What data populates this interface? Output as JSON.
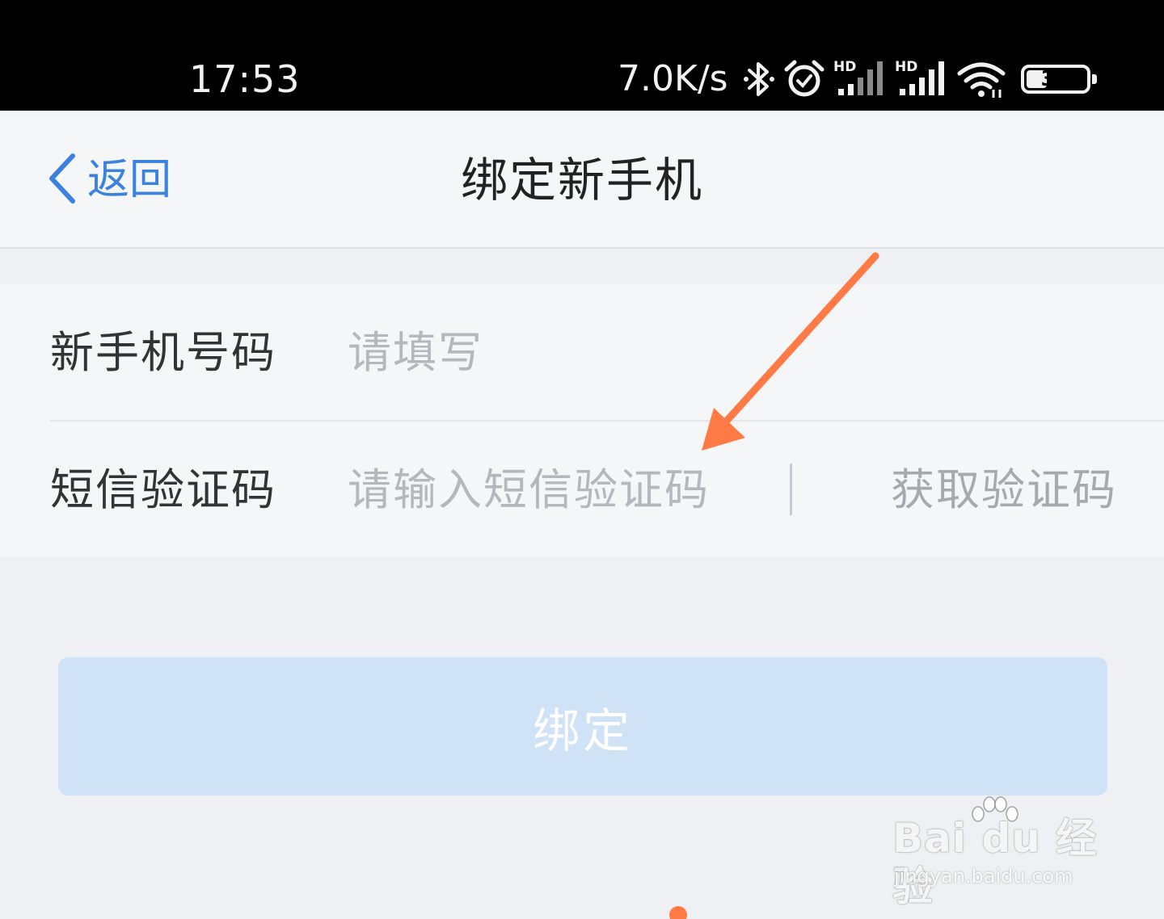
{
  "status_bar": {
    "time": "17:53",
    "net_speed": "7.0K/s",
    "battery_percent": "35",
    "battery_level": 0.35,
    "icons": [
      "bluetooth-icon",
      "alarm-icon",
      "hd-signal-icon",
      "hd-signal-icon",
      "wifi-icon",
      "battery-icon"
    ]
  },
  "nav": {
    "back_label": "返回",
    "title": "绑定新手机"
  },
  "form": {
    "phone_label": "新手机号码",
    "phone_placeholder": "请填写",
    "code_label": "短信验证码",
    "code_placeholder": "请输入短信验证码",
    "get_code_label": "获取验证码"
  },
  "bind_button_label": "绑定",
  "colors": {
    "accent": "#3b82e0",
    "annotation": "#ff7a45",
    "button_disabled": "#cfe2f6"
  },
  "watermark": {
    "logo": "Bai du 经验",
    "url": "jingyan.baidu.com"
  }
}
